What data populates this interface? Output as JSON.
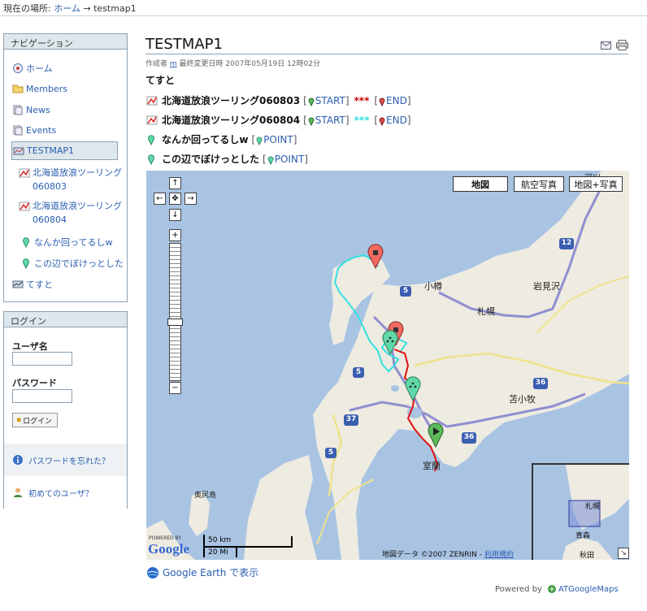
{
  "breadcrumb": {
    "prefix": "現在の場所:",
    "home": "ホーム",
    "arrow": "→",
    "current": "testmap1"
  },
  "nav": {
    "title": "ナビゲーション",
    "items": [
      {
        "label": "ホーム",
        "icon": "home-icon"
      },
      {
        "label": "Members",
        "icon": "folder-icon"
      },
      {
        "label": "News",
        "icon": "news-icon"
      },
      {
        "label": "Events",
        "icon": "events-icon"
      },
      {
        "label": "TESTMAP1",
        "icon": "map-icon"
      },
      {
        "label": "北海道放浪ツーリング060803",
        "icon": "route-icon"
      },
      {
        "label": "北海道放浪ツーリング060804",
        "icon": "route-icon"
      },
      {
        "label": "なんか回ってるしw",
        "icon": "point-marker-icon"
      },
      {
        "label": "この辺でぼけっとした",
        "icon": "point-marker-icon"
      },
      {
        "label": "てすと",
        "icon": "map-icon"
      }
    ]
  },
  "login": {
    "title": "ログイン",
    "username_label": "ユーザ名",
    "password_label": "パスワード",
    "button_label": "ログイン",
    "forgot_label": "パスワードを忘れた？",
    "new_user_label": "初めてのユーザ？"
  },
  "content": {
    "title": "TESTMAP1",
    "byline_prefix": "作成者",
    "author": "m",
    "byline_suffix": "最終変更日時 2007年05月19日 12時02分",
    "description": "てすと",
    "routes": [
      {
        "name": "北海道放浪ツーリング060803",
        "start": "START",
        "stars": "***",
        "star_color": "#cc0000",
        "end": "END"
      },
      {
        "name": "北海道放浪ツーリング060804",
        "start": "START",
        "stars": "***",
        "star_color": "#33dddd",
        "end": "END"
      }
    ],
    "points": [
      {
        "name": "なんか回ってるしw",
        "label": "POINT"
      },
      {
        "name": "この辺でぼけっとした",
        "label": "POINT"
      }
    ]
  },
  "map": {
    "type_buttons": [
      "地図",
      "航空写真",
      "地図+写真"
    ],
    "active_type": "地図",
    "place_labels": [
      "小樽",
      "岩見沢",
      "札幌",
      "苫小牧",
      "室蘭",
      "奥尻島",
      "深川"
    ],
    "road_numbers": [
      "12",
      "5",
      "5",
      "36",
      "36",
      "37",
      "5"
    ],
    "scale_km": "50 km",
    "scale_mi": "20 Mi",
    "powered_by": "POWERED BY",
    "google": "Google",
    "copyright": "地図データ ©2007 ZENRIN -",
    "terms": "利用規約",
    "minimap_labels": [
      "札幌",
      "青森",
      "秋田"
    ]
  },
  "footer": {
    "google_earth": "Google Earth で表示",
    "powered_by": "Powered by",
    "atgooglemaps": "ATGoogleMaps"
  }
}
